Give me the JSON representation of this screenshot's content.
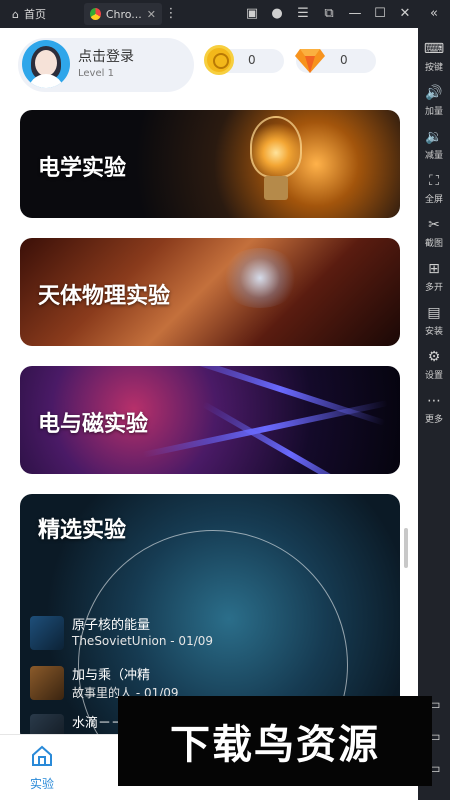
{
  "emulator": {
    "tabs": [
      {
        "label": "首页"
      },
      {
        "label": "Chro..."
      }
    ],
    "sidebar": [
      {
        "label": "按键"
      },
      {
        "label": "加量"
      },
      {
        "label": "减量"
      },
      {
        "label": "全屏"
      },
      {
        "label": "截图"
      },
      {
        "label": "多开"
      },
      {
        "label": "安装"
      },
      {
        "label": "设置"
      },
      {
        "label": "更多"
      }
    ]
  },
  "header": {
    "login_text": "点击登录",
    "level_text": "Level 1",
    "coins": "0",
    "gems": "0"
  },
  "cards": [
    {
      "title": "电学实验"
    },
    {
      "title": "天体物理实验"
    },
    {
      "title": "电与磁实验"
    },
    {
      "title": "精选实验"
    }
  ],
  "featured": [
    {
      "title": "原子核的能量",
      "subtitle": "TheSovietUnion - 01/09"
    },
    {
      "title": "加与乘（冲精",
      "subtitle": "故事里的人 - 01/09"
    },
    {
      "title": "水滴－－",
      "subtitle": ""
    }
  ],
  "bottom_nav": [
    {
      "label": "实验",
      "active": true
    }
  ],
  "watermark": "下载鸟资源",
  "colors": {
    "accent": "#2a8ad8",
    "pill_bg": "#eef1f7"
  }
}
